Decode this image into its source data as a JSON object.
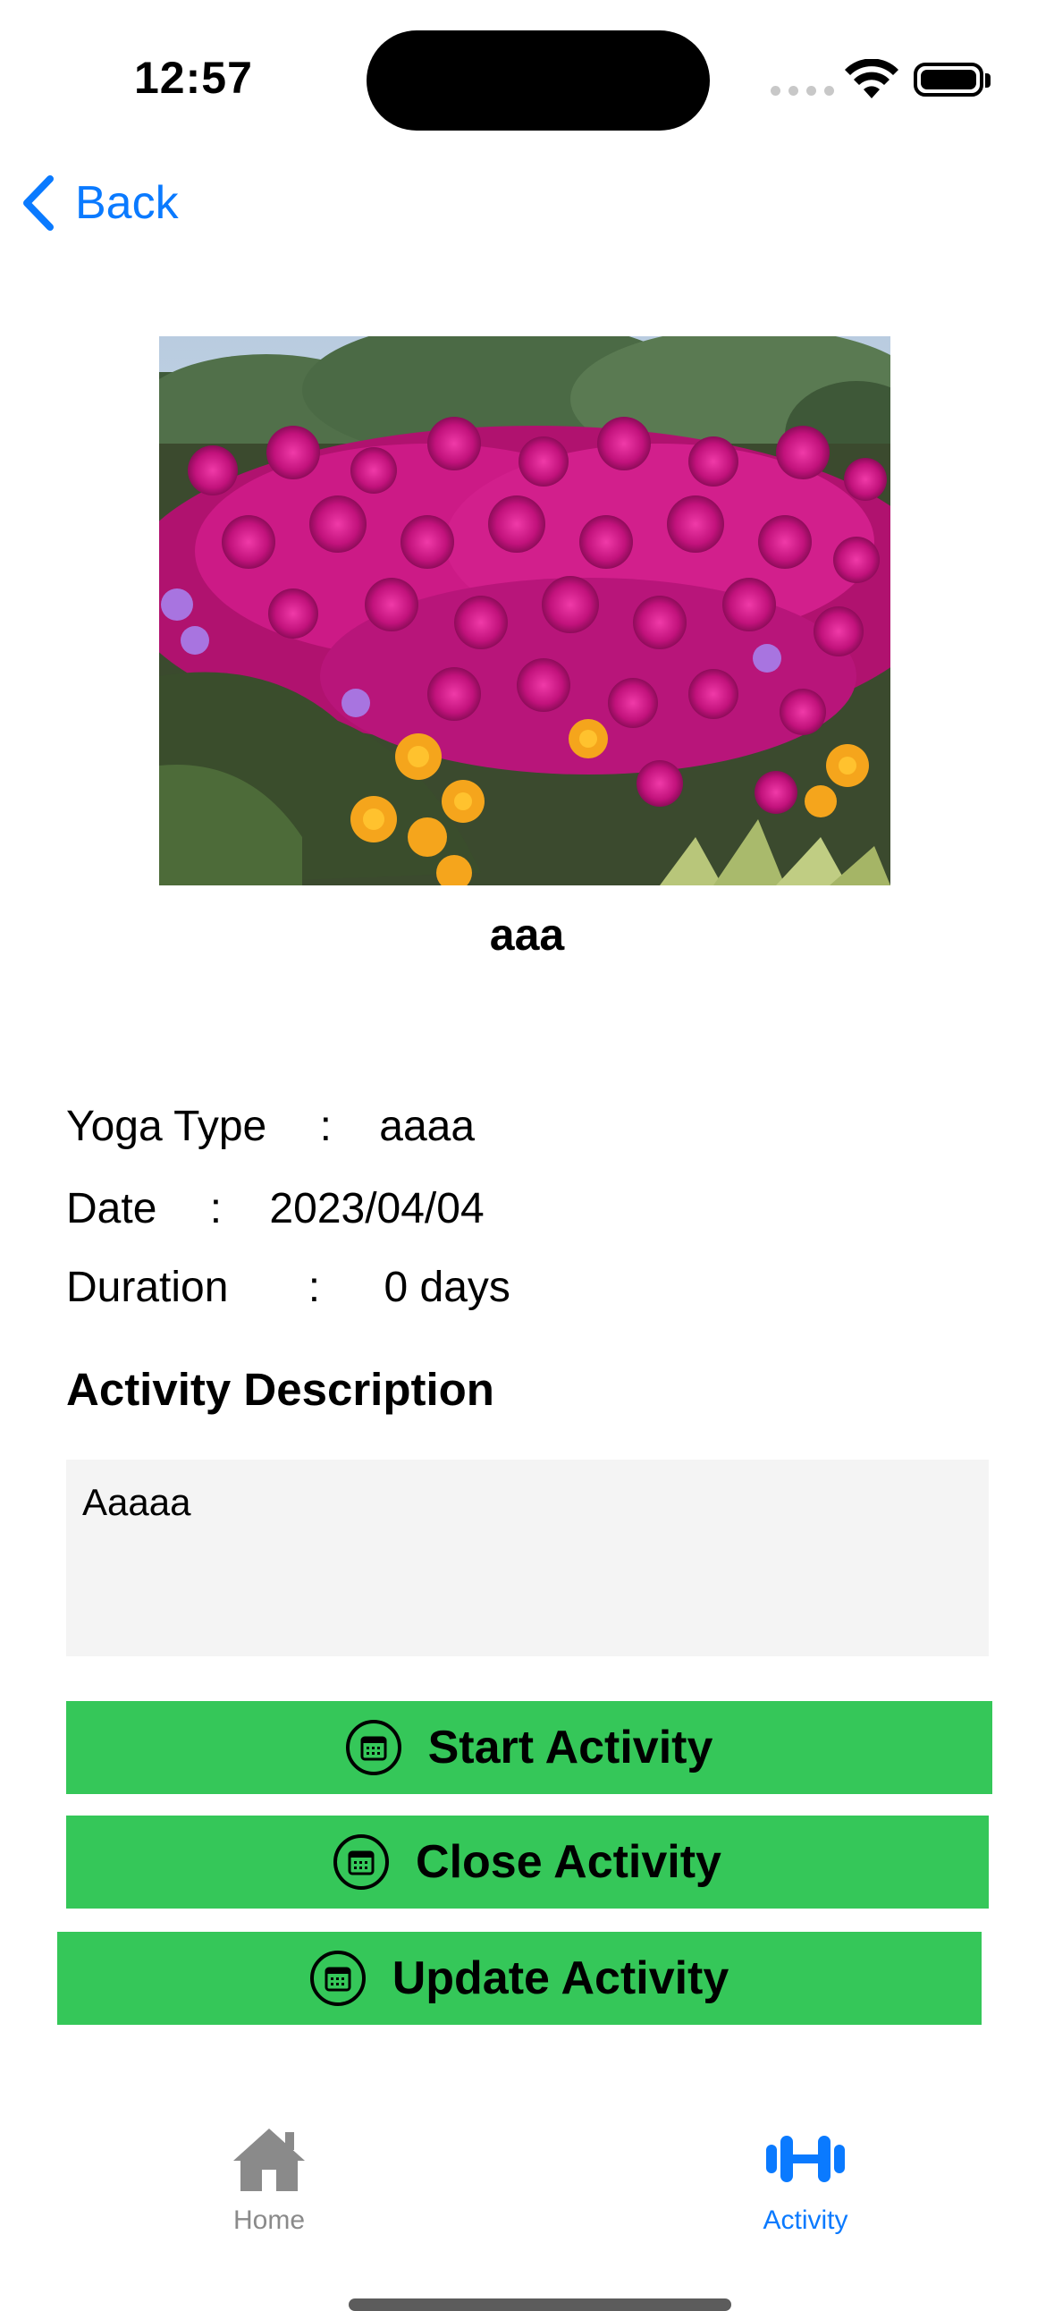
{
  "status_bar": {
    "time": "12:57"
  },
  "nav": {
    "back_label": "Back"
  },
  "activity": {
    "title": "aaa",
    "yoga_type_label": "Yoga Type",
    "yoga_type_value": "aaaa",
    "date_label": "Date",
    "date_value": "2023/04/04",
    "duration_label": "Duration",
    "duration_value": "0 days",
    "separator": ":"
  },
  "description": {
    "heading": "Activity Description",
    "text": "Aaaaa"
  },
  "buttons": {
    "start": "Start Activity",
    "close": "Close Activity",
    "update": "Update Activity"
  },
  "tab_bar": {
    "items": [
      {
        "label": "Home",
        "icon": "house-icon",
        "selected": false
      },
      {
        "label": "Activity",
        "icon": "dumbbell-icon",
        "selected": true
      }
    ],
    "active_color": "#0a7aff",
    "inactive_color": "#8a8a8a"
  },
  "colors": {
    "button_bg": "#35c759",
    "accent": "#0a7aff"
  }
}
